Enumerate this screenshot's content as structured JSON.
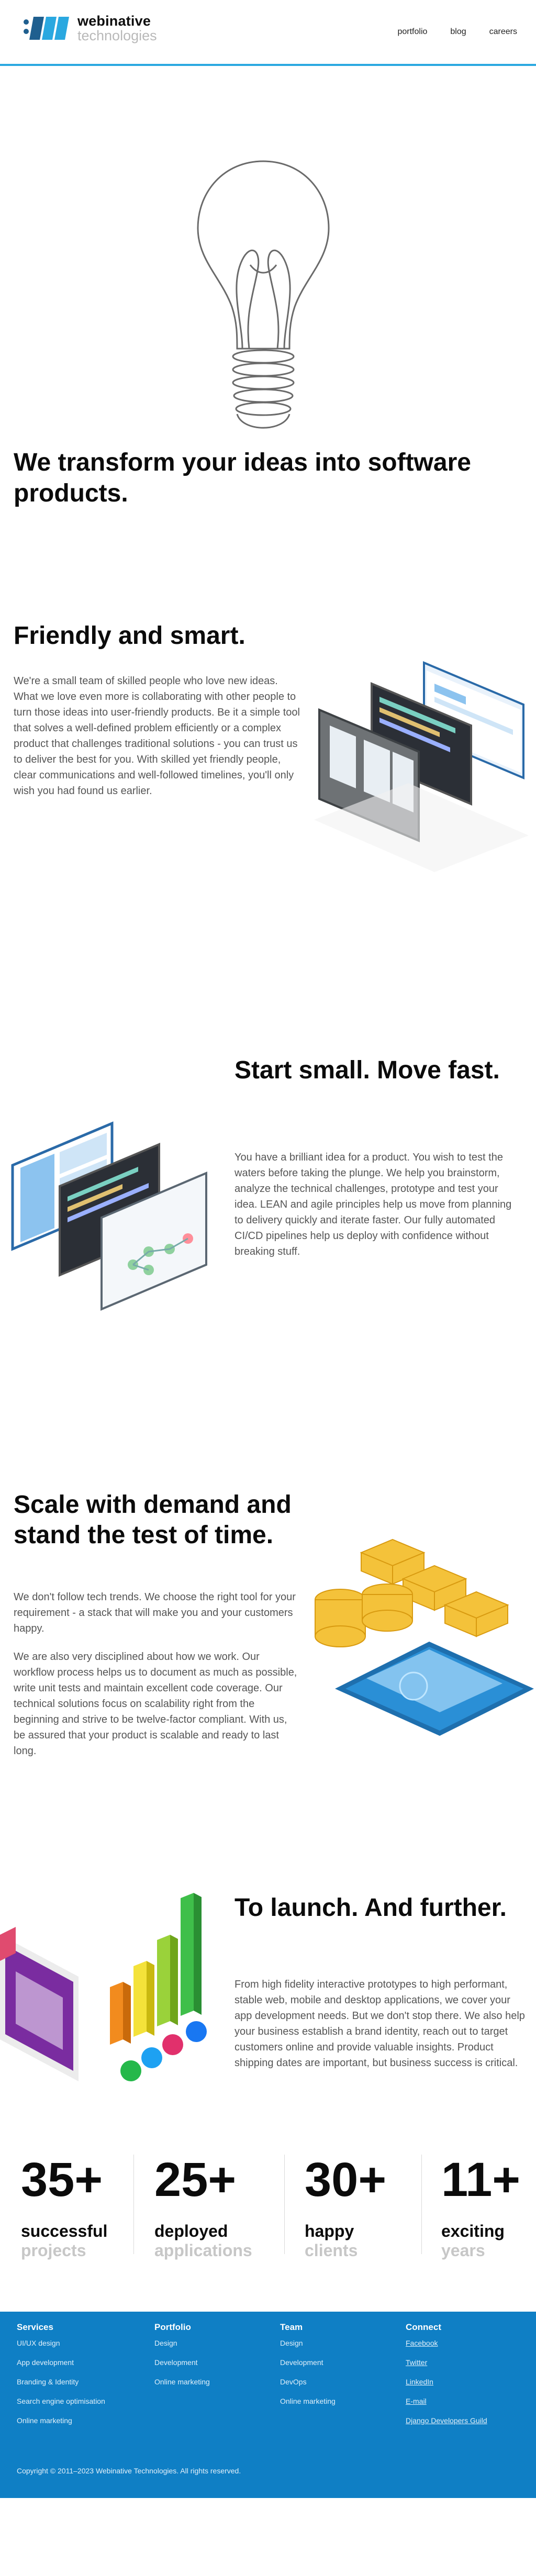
{
  "header": {
    "brand_name": "webinative",
    "brand_sub": "technologies",
    "nav": [
      "portfolio",
      "blog",
      "careers"
    ]
  },
  "colors": {
    "accent": "#2aa8e0",
    "brand_blue": "#0f7fc5",
    "logo_dark": "#1f5f8f",
    "muted_text": "#555555",
    "muted_label": "#c7c7c7"
  },
  "hero": {
    "title": "We transform your ideas into software products."
  },
  "sections": [
    {
      "title": "Friendly and smart.",
      "paragraphs": [
        "We're a small team of skilled people who love new ideas. What we love even more is collaborating with other people to turn those ideas into user-friendly products. Be it a simple tool that solves a well-defined problem efficiently or a complex product that challenges traditional solutions - you can trust us to deliver the best for you. With skilled yet friendly people, clear communications and well-followed timelines, you'll only wish you had found us earlier."
      ]
    },
    {
      "title": "Start small. Move fast.",
      "paragraphs": [
        "You have a brilliant idea for a product. You wish to test the waters before taking the plunge. We help you brainstorm, analyze the technical challenges, prototype and test your idea. LEAN and agile principles help us move from planning to delivery quickly and iterate faster. Our fully automated CI/CD pipelines help us deploy with confidence without breaking stuff."
      ]
    },
    {
      "title": "Scale with demand and stand the test of time.",
      "paragraphs": [
        "We don't follow tech trends. We choose the right tool for your requirement - a stack that will make you and your customers happy.",
        "We are also very disciplined about how we work. Our workflow process helps us to document as much as possible, write unit tests and maintain excellent code coverage. Our technical solutions focus on scalability right from the beginning and strive to be twelve-factor compliant. With us, be assured that your product is scalable and ready to last long."
      ]
    },
    {
      "title": "To launch. And further.",
      "paragraphs": [
        "From high fidelity interactive prototypes to high performant, stable web, mobile and desktop applications, we cover your app development needs. But we don't stop there. We also help your business establish a brand identity, reach out to target customers online and provide valuable insights. Product shipping dates are important, but business success is critical."
      ]
    }
  ],
  "stats": [
    {
      "number": "35+",
      "line1": "successful",
      "line2": "projects"
    },
    {
      "number": "25+",
      "line1": "deployed",
      "line2": "applications"
    },
    {
      "number": "30+",
      "line1": "happy",
      "line2": "clients"
    },
    {
      "number": "11+",
      "line1": "exciting",
      "line2": "years"
    }
  ],
  "footer": {
    "columns": [
      {
        "heading": "Services",
        "links": [
          "UI/UX design",
          "App development",
          "Branding & Identity",
          "Search engine optimisation",
          "Online marketing"
        ]
      },
      {
        "heading": "Portfolio",
        "links": [
          "Design",
          "Development",
          "Online marketing"
        ]
      },
      {
        "heading": "Team",
        "links": [
          "Design",
          "Development",
          "DevOps",
          "Online marketing"
        ]
      },
      {
        "heading": "Connect",
        "links": [
          "Facebook",
          "Twitter",
          "LinkedIn",
          "E-mail",
          "Django Developers Guild"
        ]
      }
    ],
    "copyright": "Copyright © 2011–2023 Webinative Technologies. All rights reserved."
  }
}
